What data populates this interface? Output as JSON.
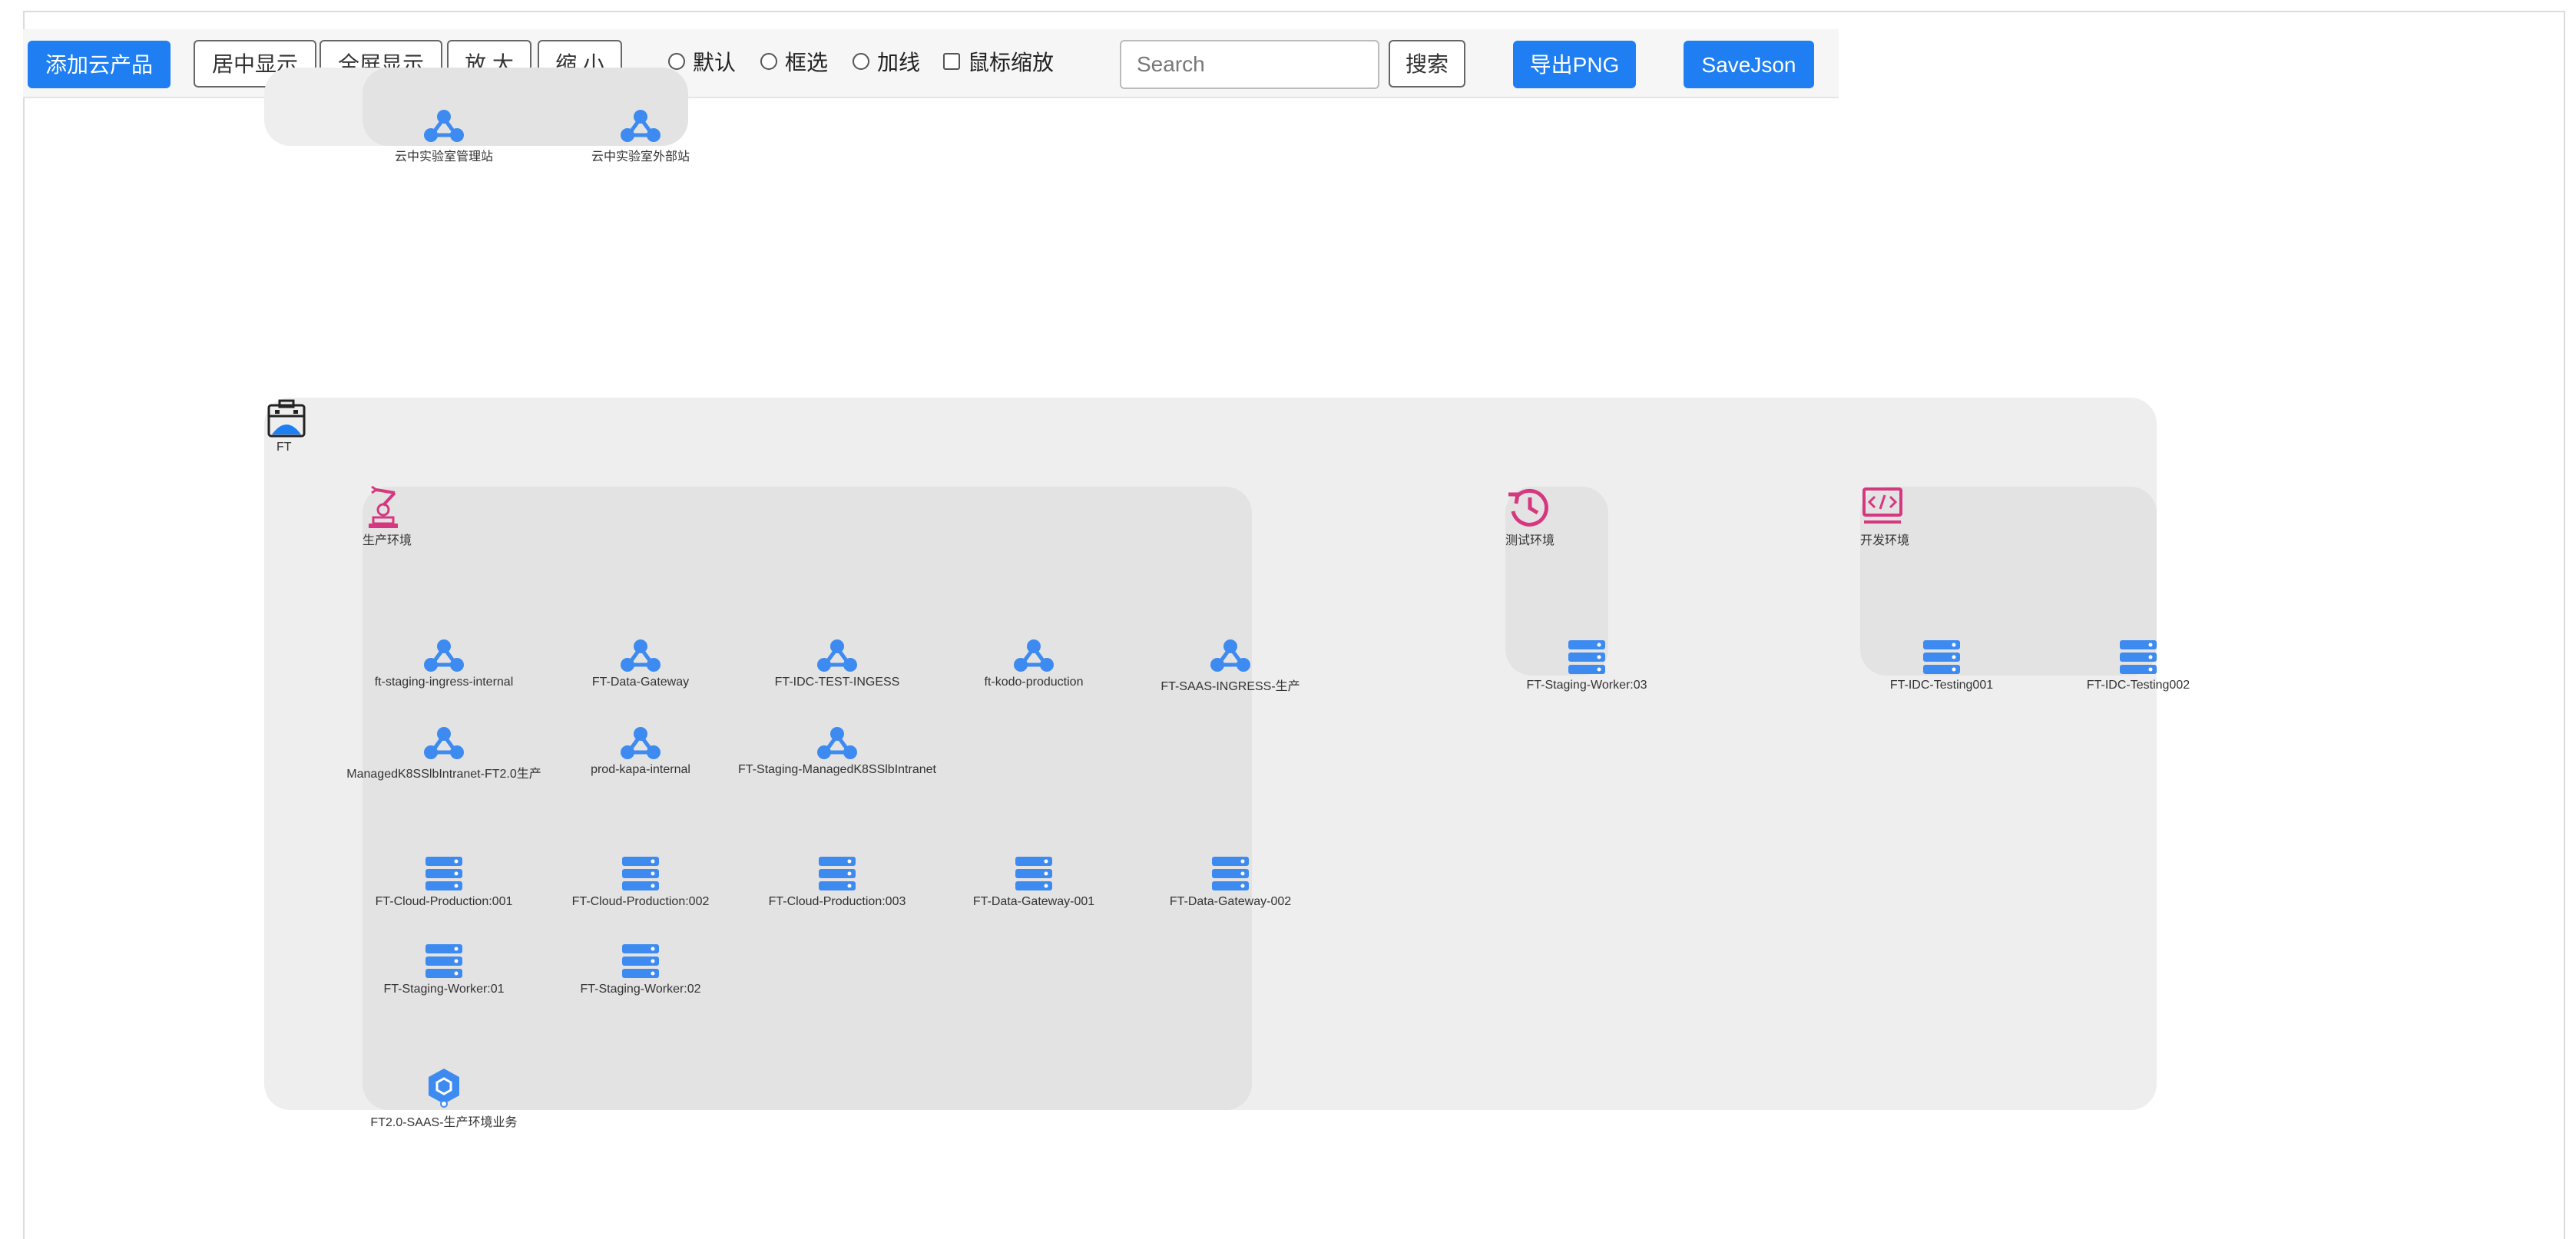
{
  "toolbar": {
    "add_cloud_product": "添加云产品",
    "center_view": "居中显示",
    "fullscreen": "全屏显示",
    "zoom_in": "放 大",
    "zoom_out": "缩 小",
    "modes": [
      "默认",
      "框选",
      "加线"
    ],
    "mouse_zoom": "鼠标缩放",
    "search_placeholder": "Search",
    "search_button": "搜索",
    "export_png": "导出PNG",
    "save_json": "SaveJson"
  },
  "colors": {
    "primary": "#1e7ef2",
    "node_blue": "#3d8bf0",
    "group_pink": "#d6387f"
  },
  "top_nodes": [
    "云中实验室管理站",
    "云中实验室外部站"
  ],
  "groups": {
    "ft": "FT",
    "production": "生产环境",
    "test": "测试环境",
    "dev": "开发环境"
  },
  "production": {
    "network_row1": [
      "ft-staging-ingress-internal",
      "FT-Data-Gateway",
      "FT-IDC-TEST-INGESS",
      "ft-kodo-production",
      "FT-SAAS-INGRESS-生产"
    ],
    "network_row2": [
      "ManagedK8SSlbIntranet-FT2.0生产",
      "prod-kapa-internal",
      "FT-Staging-ManagedK8SSlbIntranet"
    ],
    "server_row1": [
      "FT-Cloud-Production:001",
      "FT-Cloud-Production:002",
      "FT-Cloud-Production:003",
      "FT-Data-Gateway-001",
      "FT-Data-Gateway-002"
    ],
    "server_row2": [
      "FT-Staging-Worker:01",
      "FT-Staging-Worker:02"
    ],
    "service": "FT2.0-SAAS-生产环境业务"
  },
  "test_nodes": [
    "FT-Staging-Worker:03"
  ],
  "dev_nodes": [
    "FT-IDC-Testing001",
    "FT-IDC-Testing002"
  ]
}
